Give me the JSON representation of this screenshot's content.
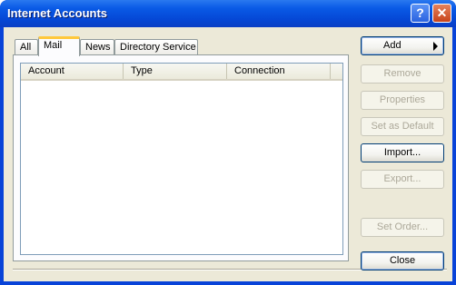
{
  "window": {
    "title": "Internet Accounts",
    "help_glyph": "?",
    "close_glyph": "✕"
  },
  "tabs": [
    {
      "label": "All",
      "active": false
    },
    {
      "label": "Mail",
      "active": true
    },
    {
      "label": "News",
      "active": false
    },
    {
      "label": "Directory Service",
      "active": false
    }
  ],
  "table": {
    "columns": [
      "Account",
      "Type",
      "Connection"
    ],
    "rows": []
  },
  "buttons": {
    "add": "Add",
    "remove": "Remove",
    "properties": "Properties",
    "set_default": "Set as Default",
    "import": "Import...",
    "export": "Export...",
    "set_order": "Set Order...",
    "close": "Close"
  }
}
